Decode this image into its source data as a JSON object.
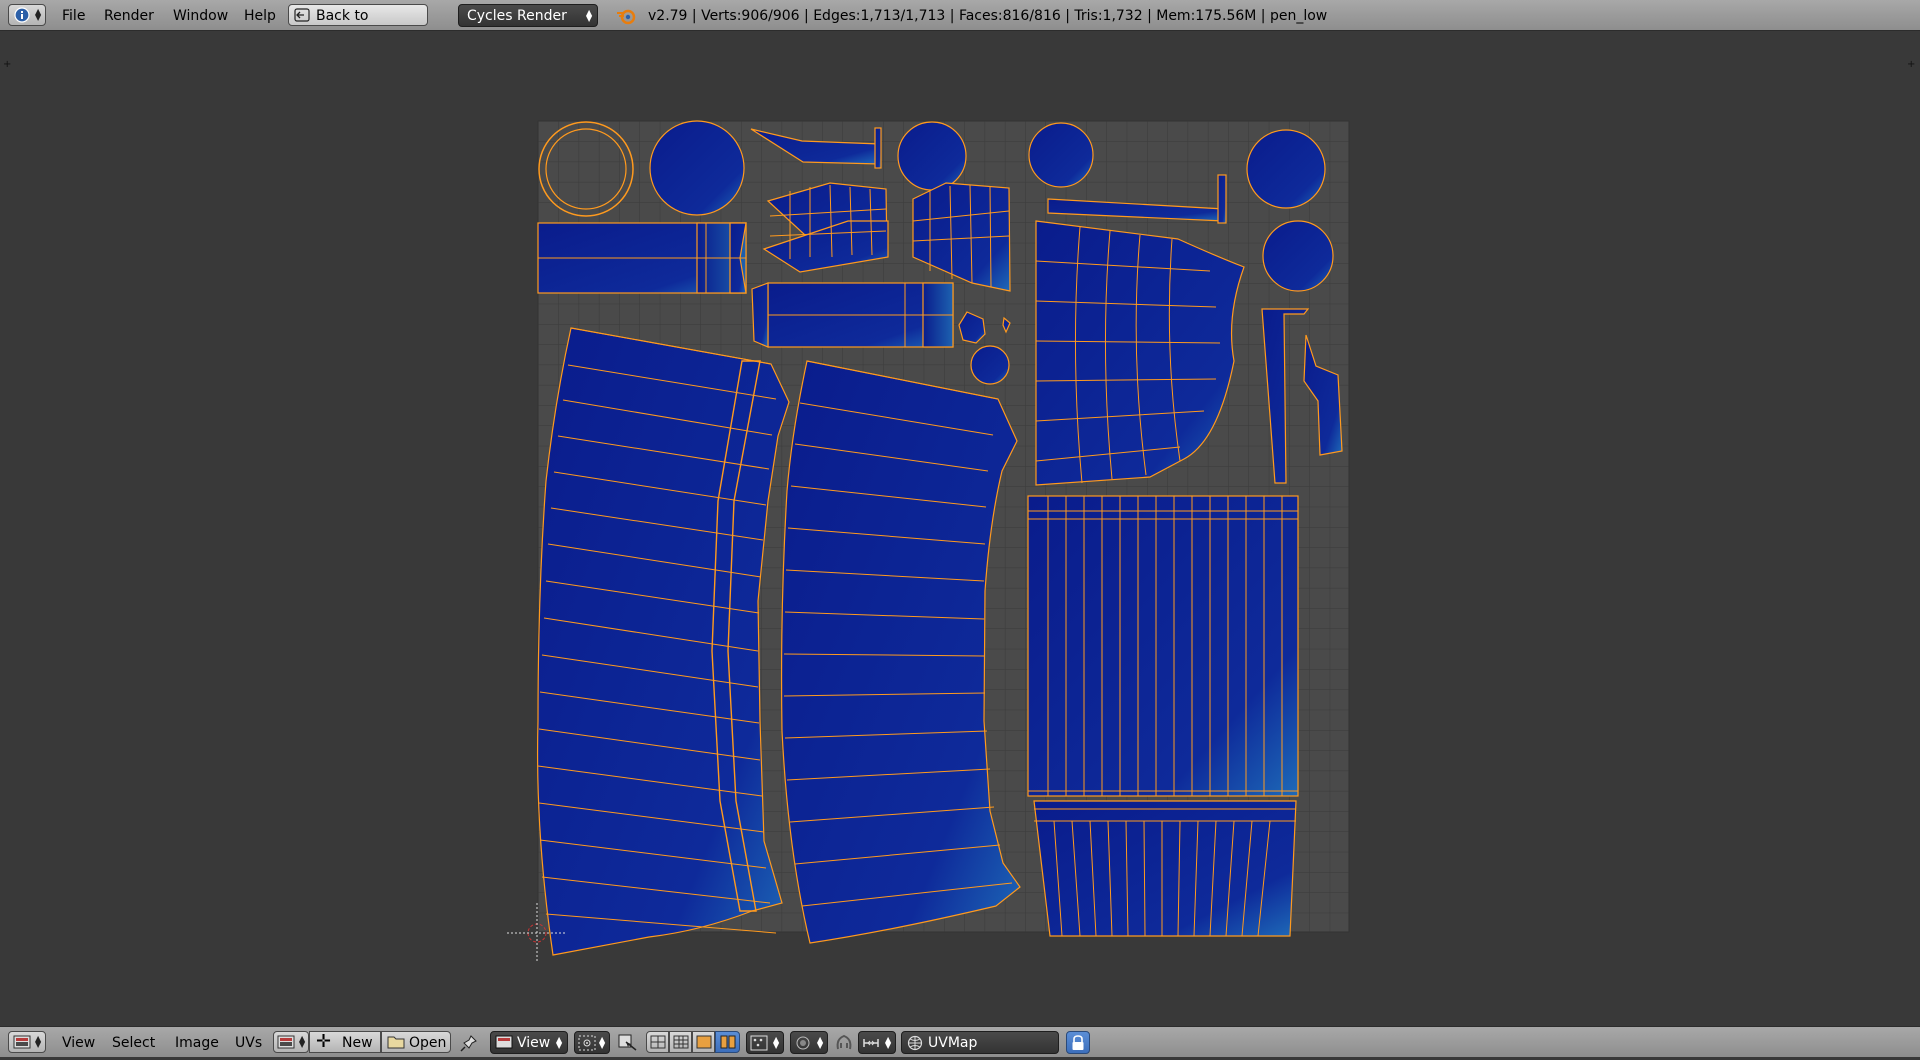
{
  "header": {
    "menus": [
      "File",
      "Render",
      "Window",
      "Help"
    ],
    "back_button": "Back to Previous",
    "render_engine": "Cycles Render",
    "stats": "v2.79 | Verts:906/906 | Edges:1,713/1,713 | Faces:816/816 | Tris:1,732 | Mem:175.56M | pen_low"
  },
  "footer": {
    "menus": [
      "View",
      "Select",
      "Image",
      "UVs"
    ],
    "new_label": "New",
    "open_label": "Open",
    "view_dropdown": "View",
    "uv_map": "UVMap"
  },
  "colors": {
    "uv_fill": "#0a1c8c",
    "uv_highlight": "#1e6ab8",
    "uv_edge": "#ff9a1e",
    "grid_bg": "#4a4a4a",
    "grid_line": "#3a3a3a",
    "viewport_bg": "#393939",
    "header_bg": "#9a9a9a"
  },
  "icons": {
    "info_editor": "info-icon",
    "blender_logo": "blender-logo-icon",
    "image_editor": "image-editor-icon",
    "pin": "pin-icon",
    "lock": "lock-icon"
  }
}
